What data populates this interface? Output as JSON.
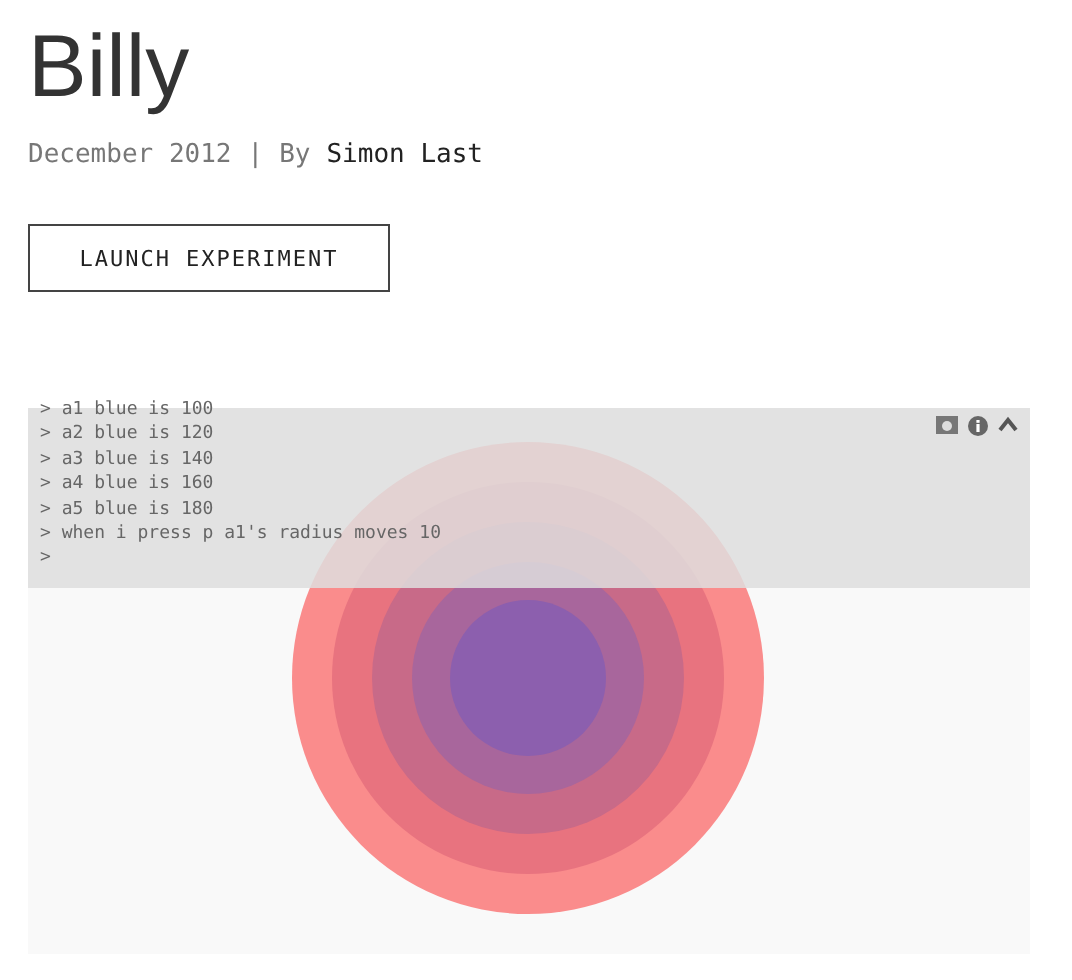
{
  "title": "Billy",
  "meta": {
    "date": "December 2012",
    "separator": "|",
    "by": "By",
    "author": "Simon Last"
  },
  "button": "LAUNCH EXPERIMENT",
  "console": {
    "lines": [
      "> a1 blue is 100",
      "> a2 blue is 120",
      "> a3 blue is 140",
      "> a4 blue is 160",
      "> a5 blue is 180",
      "> when i press p a1's radius moves 10",
      ">"
    ]
  }
}
